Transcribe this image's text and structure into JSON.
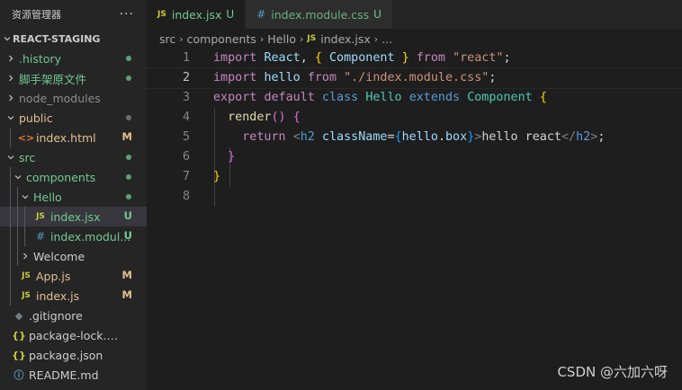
{
  "explorer": {
    "title": "资源管理器",
    "more": "···",
    "project": "REACT-STAGING",
    "tree": [
      {
        "name": ".history",
        "depth": 1,
        "kind": "folder",
        "open": false,
        "color": "untracked",
        "mark": "dot",
        "markColor": "green"
      },
      {
        "name": "脚手架原文件",
        "depth": 1,
        "kind": "folder",
        "open": false,
        "color": "untracked",
        "mark": "dot",
        "markColor": "green"
      },
      {
        "name": "node_modules",
        "depth": 1,
        "kind": "folder",
        "open": false,
        "color": "ignored",
        "mark": "",
        "markColor": ""
      },
      {
        "name": "public",
        "depth": 1,
        "kind": "folder",
        "open": true,
        "color": "mod",
        "mark": "dot",
        "markColor": "gray"
      },
      {
        "name": "index.html",
        "depth": 2,
        "kind": "html",
        "color": "mod",
        "mark": "M",
        "markColor": "m"
      },
      {
        "name": "src",
        "depth": 1,
        "kind": "folder",
        "open": true,
        "color": "untracked",
        "mark": "dot",
        "markColor": "green"
      },
      {
        "name": "components",
        "depth": 2,
        "kind": "folder",
        "open": true,
        "color": "untracked",
        "mark": "dot",
        "markColor": "green"
      },
      {
        "name": "Hello",
        "depth": 3,
        "kind": "folder",
        "open": true,
        "color": "untracked",
        "mark": "dot",
        "markColor": "green"
      },
      {
        "name": "index.jsx",
        "depth": 4,
        "kind": "js",
        "color": "untracked",
        "mark": "U",
        "markColor": "u",
        "selected": true
      },
      {
        "name": "index.modul...",
        "depth": 4,
        "kind": "css",
        "color": "untracked",
        "mark": "U",
        "markColor": "u"
      },
      {
        "name": "Welcome",
        "depth": 3,
        "kind": "folder",
        "open": false,
        "color": "plain",
        "mark": "",
        "markColor": ""
      },
      {
        "name": "App.js",
        "depth": 2,
        "kind": "js",
        "color": "mod",
        "mark": "M",
        "markColor": "m"
      },
      {
        "name": "index.js",
        "depth": 2,
        "kind": "js",
        "color": "mod",
        "mark": "M",
        "markColor": "m"
      },
      {
        "name": ".gitignore",
        "depth": 1,
        "kind": "git",
        "color": "plain",
        "mark": "",
        "markColor": ""
      },
      {
        "name": "package-lock.json",
        "depth": 1,
        "kind": "json",
        "color": "plain",
        "mark": "",
        "markColor": ""
      },
      {
        "name": "package.json",
        "depth": 1,
        "kind": "json",
        "color": "plain",
        "mark": "",
        "markColor": ""
      },
      {
        "name": "README.md",
        "depth": 1,
        "kind": "info",
        "color": "plain",
        "mark": "",
        "markColor": ""
      }
    ]
  },
  "tabs": [
    {
      "icon": "JS",
      "label": "index.jsx",
      "status": "U",
      "active": true
    },
    {
      "icon": "#",
      "label": "index.module.css",
      "status": "U",
      "active": false
    }
  ],
  "breadcrumb": {
    "parts": [
      "src",
      "components",
      "Hello"
    ],
    "file_icon": "JS",
    "file": "index.jsx",
    "trailing": "..."
  },
  "code": {
    "active_line": 2,
    "lines": [
      {
        "n": "1",
        "tokens": [
          [
            "import",
            "k-purple"
          ],
          [
            " ",
            "k-plain"
          ],
          [
            "React",
            "k-var"
          ],
          [
            ", ",
            "k-plain"
          ],
          [
            "{",
            "k-gold"
          ],
          [
            " ",
            "k-plain"
          ],
          [
            "Component",
            "k-var"
          ],
          [
            " ",
            "k-plain"
          ],
          [
            "}",
            "k-gold"
          ],
          [
            " ",
            "k-plain"
          ],
          [
            "from",
            "k-purple"
          ],
          [
            " ",
            "k-plain"
          ],
          [
            "\"react\"",
            "k-str"
          ],
          [
            ";",
            "k-plain"
          ]
        ]
      },
      {
        "n": "2",
        "tokens": [
          [
            "import",
            "k-purple"
          ],
          [
            " ",
            "k-plain"
          ],
          [
            "hello",
            "k-var"
          ],
          [
            " ",
            "k-plain"
          ],
          [
            "from",
            "k-purple"
          ],
          [
            " ",
            "k-plain"
          ],
          [
            "\"./index.module.css\"",
            "k-str"
          ],
          [
            ";",
            "k-plain"
          ]
        ]
      },
      {
        "n": "3",
        "tokens": [
          [
            "export",
            "k-purple"
          ],
          [
            " ",
            "k-plain"
          ],
          [
            "default",
            "k-purple"
          ],
          [
            " ",
            "k-plain"
          ],
          [
            "class",
            "k-blue"
          ],
          [
            " ",
            "k-plain"
          ],
          [
            "Hello",
            "k-cls"
          ],
          [
            " ",
            "k-plain"
          ],
          [
            "extends",
            "k-blue"
          ],
          [
            " ",
            "k-plain"
          ],
          [
            "Component",
            "k-cls"
          ],
          [
            " ",
            "k-plain"
          ],
          [
            "{",
            "k-gold"
          ]
        ]
      },
      {
        "n": "4",
        "tokens": [
          [
            "  ",
            "k-plain"
          ],
          [
            "render",
            "k-fn"
          ],
          [
            "()",
            "k-pink"
          ],
          [
            " ",
            "k-plain"
          ],
          [
            "{",
            "k-pink"
          ]
        ]
      },
      {
        "n": "5",
        "tokens": [
          [
            "    ",
            "k-plain"
          ],
          [
            "return",
            "k-purple"
          ],
          [
            " ",
            "k-plain"
          ],
          [
            "<",
            "k-tag"
          ],
          [
            "h2",
            "k-blue"
          ],
          [
            " ",
            "k-plain"
          ],
          [
            "className",
            "k-attr"
          ],
          [
            "=",
            "k-plain"
          ],
          [
            "{",
            "k-lblue"
          ],
          [
            "hello",
            "k-var"
          ],
          [
            ".",
            "k-plain"
          ],
          [
            "box",
            "k-var"
          ],
          [
            "}",
            "k-lblue"
          ],
          [
            ">",
            "k-tag"
          ],
          [
            "hello react",
            "k-plain"
          ],
          [
            "</",
            "k-tag"
          ],
          [
            "h2",
            "k-blue"
          ],
          [
            ">",
            "k-tag"
          ],
          [
            ";",
            "k-plain"
          ]
        ]
      },
      {
        "n": "6",
        "tokens": [
          [
            "  ",
            "k-plain"
          ],
          [
            "}",
            "k-pink"
          ]
        ]
      },
      {
        "n": "7",
        "tokens": [
          [
            "}",
            "k-gold"
          ]
        ]
      },
      {
        "n": "8",
        "tokens": []
      }
    ]
  },
  "watermark": "CSDN @六加六呀"
}
